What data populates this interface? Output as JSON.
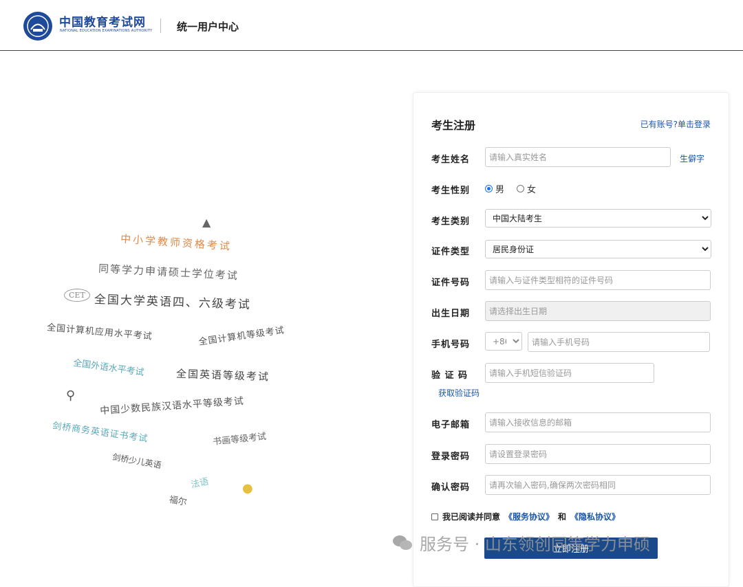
{
  "header": {
    "logo_cn": "中国教育考试网",
    "logo_en": "NATIONAL EDUCATION EXAMINATIONS AUTHORITY",
    "center_title": "统一用户中心"
  },
  "art": {
    "items": [
      "中小学教师资格考试",
      "同等学力申请硕士学位考试",
      "CET",
      "全国大学英语四、六级考试",
      "全国计算机应用水平考试",
      "全国计算机等级考试",
      "全国外语水平考试",
      "全国英语等级考试",
      "中国少数民族汉语水平等级考试",
      "剑桥商务英语证书考试",
      "书画等级考试",
      "剑桥少儿英语",
      "法语",
      "福尔"
    ]
  },
  "form": {
    "title": "考生注册",
    "login_link": "已有账号?单击登录",
    "name_label": "考生姓名",
    "name_placeholder": "请输入真实姓名",
    "rare_char_link": "生僻字",
    "gender_label": "考生性别",
    "gender_male": "男",
    "gender_female": "女",
    "category_label": "考生类别",
    "category_value": "中国大陆考生",
    "id_type_label": "证件类型",
    "id_type_value": "居民身份证",
    "id_number_label": "证件号码",
    "id_number_placeholder": "请输入与证件类型相符的证件号码",
    "birth_label": "出生日期",
    "birth_placeholder": "请选择出生日期",
    "phone_label": "手机号码",
    "phone_code": "+86",
    "phone_placeholder": "请输入手机号码",
    "code_label": "验 证 码",
    "code_placeholder": "请输入手机短信验证码",
    "get_code_link": "获取验证码",
    "email_label": "电子邮箱",
    "email_placeholder": "请输入接收信息的邮箱",
    "password_label": "登录密码",
    "password_placeholder": "请设置登录密码",
    "confirm_label": "确认密码",
    "confirm_placeholder": "请再次输入密码,确保两次密码相同",
    "agree_text": "我已阅读并同意",
    "service_link": "《服务协议》",
    "and_text": "和",
    "privacy_link": "《隐私协议》",
    "submit_label": "立即注册"
  },
  "watermark": {
    "text": "服务号 · 山东领创同等学力申硕"
  },
  "colors": {
    "brand": "#1f4a9a",
    "link": "#1a56a8",
    "button": "#1a4a8a"
  }
}
